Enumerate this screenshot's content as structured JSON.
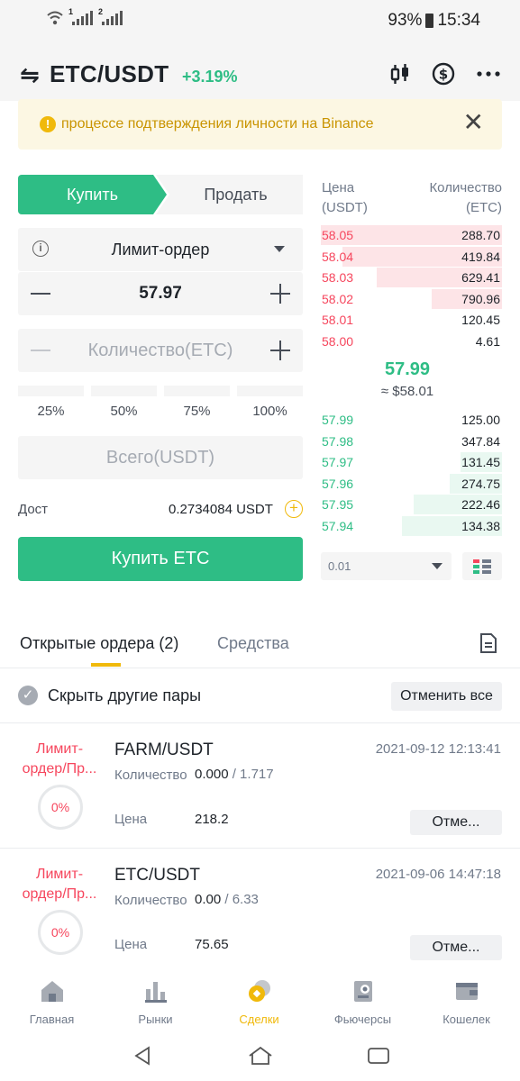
{
  "status_bar": {
    "battery": "93%",
    "time": "15:34",
    "sim1": "1",
    "sim2": "2"
  },
  "header": {
    "swap_icon": "⇋",
    "pair": "ETC/USDT",
    "change": "+3.19%",
    "icons": [
      "candlestick-chart-icon",
      "dollar-circle-icon",
      "more-icon"
    ]
  },
  "notice": {
    "text": "процессе подтверждения личности на Binance",
    "close": "✕"
  },
  "trade": {
    "buy_tab": "Купить",
    "sell_tab": "Продать",
    "order_type": "Лимит-ордер",
    "price": "57.97",
    "amount_placeholder": "Количество(ETC)",
    "percents": [
      "25%",
      "50%",
      "75%",
      "100%"
    ],
    "total_placeholder": "Всего(USDT)",
    "avail_label": "Дост",
    "avail_value": "0.2734084 USDT",
    "buy_button": "Купить ETC"
  },
  "order_book": {
    "price_header_1": "Цена",
    "price_header_2": "(USDT)",
    "qty_header_1": "Количество",
    "qty_header_2": "(ETC)",
    "asks": [
      {
        "price": "58.05",
        "qty": "288.70",
        "depth": 1.0
      },
      {
        "price": "58.04",
        "qty": "419.84",
        "depth": 0.88
      },
      {
        "price": "58.03",
        "qty": "629.41",
        "depth": 0.69
      },
      {
        "price": "58.02",
        "qty": "790.96",
        "depth": 0.39
      },
      {
        "price": "58.01",
        "qty": "120.45",
        "depth": 0.0
      },
      {
        "price": "58.00",
        "qty": "4.61",
        "depth": 0.0
      }
    ],
    "last_price": "57.99",
    "last_usd": "≈ $58.01",
    "bids": [
      {
        "price": "57.99",
        "qty": "125.00",
        "depth": 0.0
      },
      {
        "price": "57.98",
        "qty": "347.84",
        "depth": 0.0
      },
      {
        "price": "57.97",
        "qty": "131.45",
        "depth": 0.23
      },
      {
        "price": "57.96",
        "qty": "274.75",
        "depth": 0.29
      },
      {
        "price": "57.95",
        "qty": "222.46",
        "depth": 0.49
      },
      {
        "price": "57.94",
        "qty": "134.38",
        "depth": 0.55
      }
    ],
    "depth_value": "0.01"
  },
  "orders": {
    "tab_open": "Открытые ордера (2)",
    "tab_funds": "Средства",
    "hide_other": "Скрыть другие пары",
    "cancel_all": "Отменить все",
    "items": [
      {
        "type": "Лимит-ордер/Пр...",
        "progress": "0%",
        "symbol": "FARM/USDT",
        "time": "2021-09-12 12:13:41",
        "qty_label": "Количество",
        "qty_filled": "0.000",
        "qty_total": "/ 1.717",
        "price_label": "Цена",
        "price": "218.2",
        "cancel": "Отме..."
      },
      {
        "type": "Лимит-ордер/Пр...",
        "progress": "0%",
        "symbol": "ETC/USDT",
        "time": "2021-09-06 14:47:18",
        "qty_label": "Количество",
        "qty_filled": "0.00",
        "qty_total": "/ 6.33",
        "price_label": "Цена",
        "price": "75.65",
        "cancel": "Отме..."
      }
    ]
  },
  "bottom_nav": [
    {
      "label": "Главная",
      "icon": "home-icon"
    },
    {
      "label": "Рынки",
      "icon": "markets-icon"
    },
    {
      "label": "Сделки",
      "icon": "trades-icon",
      "active": true
    },
    {
      "label": "Фьючерсы",
      "icon": "futures-icon"
    },
    {
      "label": "Кошелек",
      "icon": "wallet-icon"
    }
  ],
  "colors": {
    "green": "#2ebd85",
    "red": "#f6465d",
    "yellow": "#f0b90b"
  }
}
